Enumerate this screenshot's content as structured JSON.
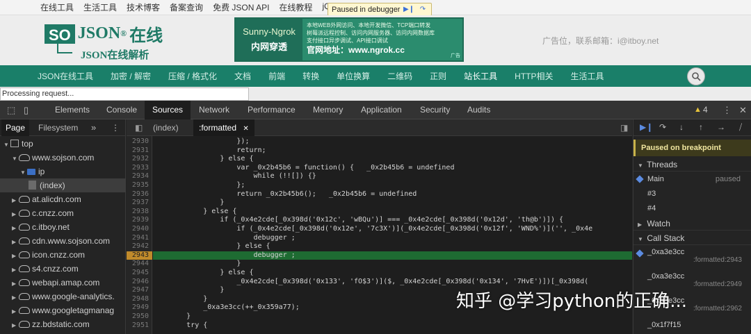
{
  "site": {
    "top_links": [
      "在线工具",
      "生活工具",
      "技术博客",
      "备案查询",
      "免费 JSON API",
      "在线教程",
      "jQu"
    ],
    "paused_pill": "Paused in debugger",
    "logo_so": "SO",
    "logo_json": "JSON",
    "logo_cn": "在线",
    "logo_reg": "®",
    "logo_sub": "JSON在线解析",
    "ad_title": "Sunny-Ngrok",
    "ad_sub": "内网穿透",
    "ad_line1": "本地WEB外网访问、本地开发微信、TCP端口转发",
    "ad_line2": "树莓派远程控制、访问内网服务器、访问内网数据库",
    "ad_line3": "支付接口异步调试、API接口调试",
    "ad_url": "官网地址：www.ngrok.cc",
    "ad_tag": "广告",
    "ad_contact": "广告位，联系邮箱：i@itboy.net",
    "nav_items": [
      "JSON在线工具",
      "加密 / 解密",
      "压缩 / 格式化",
      "文档",
      "前端",
      "转换",
      "单位换算",
      "二维码",
      "正则",
      "站长工具",
      "HTTP相关",
      "生活工具"
    ],
    "nav_active_index": 9,
    "progress_text": "Processing request..."
  },
  "devtools": {
    "tabs": [
      "Elements",
      "Console",
      "Sources",
      "Network",
      "Performance",
      "Memory",
      "Application",
      "Security",
      "Audits"
    ],
    "active_tab": "Sources",
    "warning_count": "4",
    "warning_icon": "warning-icon",
    "navigator": {
      "subtabs": [
        "Page",
        "Filesystem"
      ],
      "tree": [
        {
          "label": "top",
          "icon": "frame-icon",
          "level": 0
        },
        {
          "label": "www.sojson.com",
          "icon": "cloud-icon",
          "level": 1
        },
        {
          "label": "ip",
          "icon": "folder-icon",
          "level": 2
        },
        {
          "label": "(index)",
          "icon": "file-icon",
          "level": 3
        },
        {
          "label": "at.alicdn.com",
          "icon": "cloud-icon",
          "level": 1
        },
        {
          "label": "c.cnzz.com",
          "icon": "cloud-icon",
          "level": 1
        },
        {
          "label": "c.itboy.net",
          "icon": "cloud-icon",
          "level": 1
        },
        {
          "label": "cdn.www.sojson.com",
          "icon": "cloud-icon",
          "level": 1
        },
        {
          "label": "icon.cnzz.com",
          "icon": "cloud-icon",
          "level": 1
        },
        {
          "label": "s4.cnzz.com",
          "icon": "cloud-icon",
          "level": 1
        },
        {
          "label": "webapi.amap.com",
          "icon": "cloud-icon",
          "level": 1
        },
        {
          "label": "www.google-analytics.",
          "icon": "cloud-icon",
          "level": 1
        },
        {
          "label": "www.googletagmanag",
          "icon": "cloud-icon",
          "level": 1
        },
        {
          "label": "zz.bdstatic.com",
          "icon": "cloud-icon",
          "level": 1
        }
      ]
    },
    "editor": {
      "tabs": [
        "(index)",
        ":formatted"
      ],
      "active_tab": ":formatted",
      "current_line": "2943",
      "lines": [
        {
          "n": "2930",
          "t": "                    });"
        },
        {
          "n": "2931",
          "t": "                    return;"
        },
        {
          "n": "2932",
          "t": "                } else {"
        },
        {
          "n": "2933",
          "t": "                    var _0x2b45b6 = function() {   _0x2b45b6 = undefined"
        },
        {
          "n": "2934",
          "t": "                        while (!![]) {}"
        },
        {
          "n": "2935",
          "t": "                    };"
        },
        {
          "n": "2936",
          "t": "                    return _0x2b45b6();   _0x2b45b6 = undefined"
        },
        {
          "n": "2937",
          "t": "                }"
        },
        {
          "n": "2938",
          "t": "            } else {"
        },
        {
          "n": "2939",
          "t": "                if (_0x4e2cde[_0x398d('0x12c', 'wBQu')] === _0x4e2cde[_0x398d('0x12d', 'th@b')]) {"
        },
        {
          "n": "2940",
          "t": "                    if (_0x4e2cde[_0x398d('0x12e', '7c3X')](_0x4e2cde[_0x398d('0x12f', 'WND%')]('', _0x4e"
        },
        {
          "n": "2941",
          "t": "                        debugger ;"
        },
        {
          "n": "2942",
          "t": "                    } else {"
        },
        {
          "n": "2943",
          "t": "                        debugger ;"
        },
        {
          "n": "2944",
          "t": "                    }"
        },
        {
          "n": "2945",
          "t": "                } else {"
        },
        {
          "n": "2946",
          "t": "                    _0x4e2cde[_0x398d('0x133', 'fO$3')]($, _0x4e2cde[_0x398d('0x134', '7HvE')])[_0x398d("
        },
        {
          "n": "2947",
          "t": "                }"
        },
        {
          "n": "2948",
          "t": "            }"
        },
        {
          "n": "2949",
          "t": "            _0xa3e3cc(++_0x359a77);"
        },
        {
          "n": "2950",
          "t": "        }"
        },
        {
          "n": "2951",
          "t": "        try {"
        }
      ]
    },
    "debugger": {
      "paused_banner": "Paused on breakpoint",
      "threads_label": "Threads",
      "threads": [
        {
          "name": "Main",
          "status": "paused"
        },
        {
          "name": "#3",
          "status": ""
        },
        {
          "name": "#4",
          "status": ""
        }
      ],
      "watch_label": "Watch",
      "callstack_label": "Call Stack",
      "frames": [
        {
          "fn": "_0xa3e3cc",
          "loc": ":formatted:2943"
        },
        {
          "fn": "_0xa3e3cc",
          "loc": ":formatted:2949"
        },
        {
          "fn": "_0xa3e3cc",
          "loc": ":formatted:2962"
        },
        {
          "fn": "_0x1f7f15",
          "loc": ""
        }
      ]
    }
  },
  "watermark": "知乎 @学习python的正确..."
}
